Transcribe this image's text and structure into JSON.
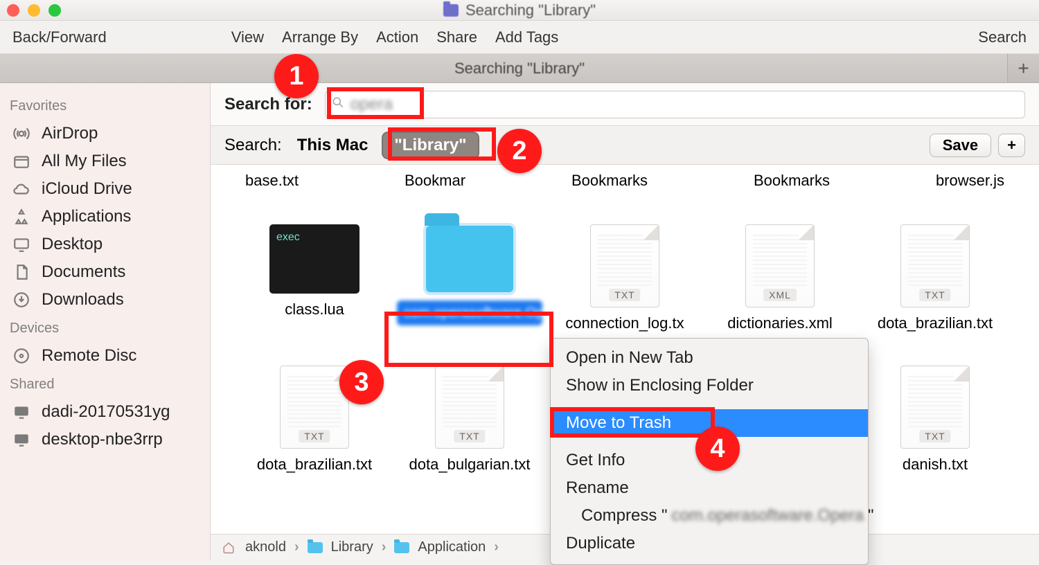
{
  "window": {
    "title": "Searching \"Library\""
  },
  "toolbar": {
    "back_forward": "Back/Forward",
    "view": "View",
    "arrange_by": "Arrange By",
    "action": "Action",
    "share": "Share",
    "add_tags": "Add Tags",
    "search": "Search"
  },
  "tab": {
    "title": "Searching \"Library\"",
    "plus": "+"
  },
  "sidebar": {
    "favorites_head": "Favorites",
    "devices_head": "Devices",
    "shared_head": "Shared",
    "items": {
      "airdrop": "AirDrop",
      "allmyfiles": "All My Files",
      "iclouddrive": "iCloud Drive",
      "applications": "Applications",
      "desktop": "Desktop",
      "documents": "Documents",
      "downloads": "Downloads",
      "remotedisc": "Remote Disc",
      "shared1": "dadi-20170531yg",
      "shared2": "desktop-nbe3rrp"
    }
  },
  "searchfor": {
    "label": "Search for:",
    "query": "opera"
  },
  "scope": {
    "label": "Search:",
    "this_mac": "This Mac",
    "library": "\"Library\"",
    "save": "Save",
    "plus": "+"
  },
  "files": {
    "r1": [
      "base.txt",
      "Bookmar",
      "Bookmarks",
      "Bookmarks",
      "browser.js"
    ],
    "r2": {
      "class": "class.lua",
      "selected": "com.operasoftware.Opera",
      "conn": "connection_log.tx",
      "dict": "dictionaries.xml",
      "dota_br": "dota_brazilian.txt"
    },
    "r3": {
      "a": "dota_brazilian.txt",
      "b": "dota_bulgarian.txt",
      "c": "danish.txt"
    },
    "tags": {
      "txt": "TXT",
      "xml": "XML",
      "exec": "exec"
    }
  },
  "context_menu": {
    "open_new_tab": "Open in New Tab",
    "show_enclosing": "Show in Enclosing Folder",
    "move_to_trash": "Move to Trash",
    "get_info": "Get Info",
    "rename": "Rename",
    "compress_prefix": "Compress \"",
    "compress_blurred": "com.operasoftware.Opera",
    "compress_suffix": "\"",
    "duplicate": "Duplicate"
  },
  "pathbar": {
    "user": "aknold",
    "library": "Library",
    "app": "Application"
  },
  "badges": {
    "b1": "1",
    "b2": "2",
    "b3": "3",
    "b4": "4"
  }
}
